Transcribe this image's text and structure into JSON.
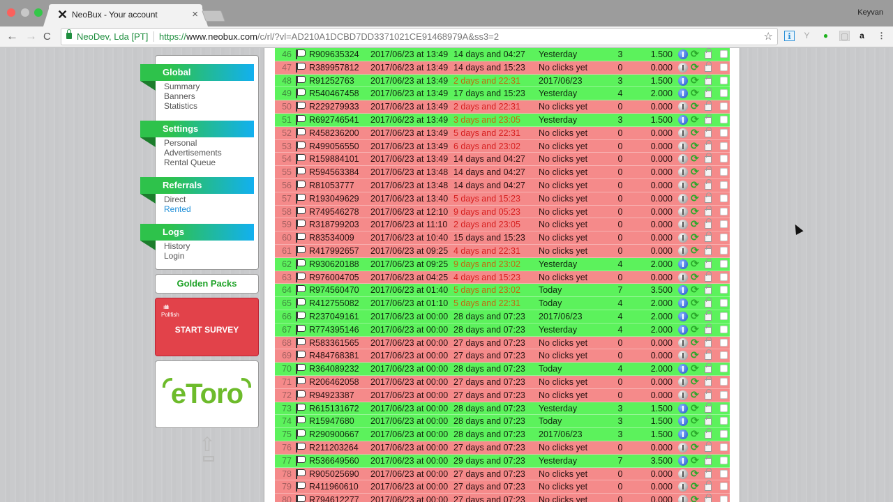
{
  "browser": {
    "tab_title": "NeoBux - Your account",
    "tab_close": "×",
    "profile_name": "Keyvan",
    "ev_certificate": "NeoDev, Lda [PT]",
    "url_scheme": "https://",
    "url_host": "www.neobux.com",
    "url_path": "/c/rl/?vl=AD210A1DCBD7DD3371021CE91468979A&ss3=2",
    "back_icon": "←",
    "forward_icon": "→",
    "reload_icon": "C",
    "star_icon": "☆",
    "extensions": [
      "ℹ",
      "Y",
      "●",
      "▢",
      "a",
      "⋮"
    ]
  },
  "sidebar": {
    "sections": [
      {
        "title": "Global",
        "items": [
          {
            "label": "Summary",
            "active": false
          },
          {
            "label": "Banners",
            "active": false
          },
          {
            "label": "Statistics",
            "active": false
          }
        ]
      },
      {
        "title": "Settings",
        "items": [
          {
            "label": "Personal",
            "active": false
          },
          {
            "label": "Advertisements",
            "active": false
          },
          {
            "label": "Rental Queue",
            "active": false
          }
        ]
      },
      {
        "title": "Referrals",
        "items": [
          {
            "label": "Direct",
            "active": false
          },
          {
            "label": "Rented",
            "active": true
          }
        ]
      },
      {
        "title": "Logs",
        "items": [
          {
            "label": "History",
            "active": false
          },
          {
            "label": "Login",
            "active": false
          }
        ]
      }
    ],
    "golden_packs": "Golden Packs",
    "survey": {
      "brand_icon": "ıılıllı",
      "brand": "Pollfish",
      "cta": "START SURVEY"
    },
    "etoro_logo": "eToro",
    "scroll_top_icon": "⇧"
  },
  "colors": {
    "active_row": "#5cf25c",
    "inactive_row": "#f58a8a",
    "menu_green": "#2ec24b",
    "menu_blue": "#12b0f0"
  },
  "referrals": [
    {
      "n": "46",
      "id": "R909635324",
      "since": "2017/06/23 at 13:49",
      "expires": "14 days and 04:27",
      "exp_warn": false,
      "last": "Yesterday",
      "clicks": "3",
      "avg": "1.500",
      "active": true
    },
    {
      "n": "47",
      "id": "R389957812",
      "since": "2017/06/23 at 13:49",
      "expires": "14 days and 15:23",
      "exp_warn": false,
      "last": "No clicks yet",
      "clicks": "0",
      "avg": "0.000",
      "active": false
    },
    {
      "n": "48",
      "id": "R91252763",
      "since": "2017/06/23 at 13:49",
      "expires": "2 days and 22:31",
      "exp_warn": true,
      "last": "2017/06/23",
      "clicks": "3",
      "avg": "1.500",
      "active": true
    },
    {
      "n": "49",
      "id": "R540467458",
      "since": "2017/06/23 at 13:49",
      "expires": "17 days and 15:23",
      "exp_warn": false,
      "last": "Yesterday",
      "clicks": "4",
      "avg": "2.000",
      "active": true
    },
    {
      "n": "50",
      "id": "R229279933",
      "since": "2017/06/23 at 13:49",
      "expires": "2 days and 22:31",
      "exp_warn": true,
      "last": "No clicks yet",
      "clicks": "0",
      "avg": "0.000",
      "active": false
    },
    {
      "n": "51",
      "id": "R692746541",
      "since": "2017/06/23 at 13:49",
      "expires": "3 days and 23:05",
      "exp_warn": true,
      "last": "Yesterday",
      "clicks": "3",
      "avg": "1.500",
      "active": true
    },
    {
      "n": "52",
      "id": "R458236200",
      "since": "2017/06/23 at 13:49",
      "expires": "5 days and 22:31",
      "exp_warn": true,
      "last": "No clicks yet",
      "clicks": "0",
      "avg": "0.000",
      "active": false
    },
    {
      "n": "53",
      "id": "R499056550",
      "since": "2017/06/23 at 13:49",
      "expires": "6 days and 23:02",
      "exp_warn": true,
      "last": "No clicks yet",
      "clicks": "0",
      "avg": "0.000",
      "active": false
    },
    {
      "n": "54",
      "id": "R159884101",
      "since": "2017/06/23 at 13:49",
      "expires": "14 days and 04:27",
      "exp_warn": false,
      "last": "No clicks yet",
      "clicks": "0",
      "avg": "0.000",
      "active": false
    },
    {
      "n": "55",
      "id": "R594563384",
      "since": "2017/06/23 at 13:48",
      "expires": "14 days and 04:27",
      "exp_warn": false,
      "last": "No clicks yet",
      "clicks": "0",
      "avg": "0.000",
      "active": false
    },
    {
      "n": "56",
      "id": "R81053777",
      "since": "2017/06/23 at 13:48",
      "expires": "14 days and 04:27",
      "exp_warn": false,
      "last": "No clicks yet",
      "clicks": "0",
      "avg": "0.000",
      "active": false
    },
    {
      "n": "57",
      "id": "R193049629",
      "since": "2017/06/23 at 13:40",
      "expires": "5 days and 15:23",
      "exp_warn": true,
      "last": "No clicks yet",
      "clicks": "0",
      "avg": "0.000",
      "active": false
    },
    {
      "n": "58",
      "id": "R749546278",
      "since": "2017/06/23 at 12:10",
      "expires": "9 days and 05:23",
      "exp_warn": true,
      "last": "No clicks yet",
      "clicks": "0",
      "avg": "0.000",
      "active": false
    },
    {
      "n": "59",
      "id": "R318799203",
      "since": "2017/06/23 at 11:10",
      "expires": "2 days and 23:05",
      "exp_warn": true,
      "last": "No clicks yet",
      "clicks": "0",
      "avg": "0.000",
      "active": false
    },
    {
      "n": "60",
      "id": "R83534009",
      "since": "2017/06/23 at 10:40",
      "expires": "15 days and 15:23",
      "exp_warn": false,
      "last": "No clicks yet",
      "clicks": "0",
      "avg": "0.000",
      "active": false
    },
    {
      "n": "61",
      "id": "R417992657",
      "since": "2017/06/23 at 09:25",
      "expires": "4 days and 22:31",
      "exp_warn": true,
      "last": "No clicks yet",
      "clicks": "0",
      "avg": "0.000",
      "active": false
    },
    {
      "n": "62",
      "id": "R930620188",
      "since": "2017/06/23 at 09:25",
      "expires": "9 days and 23:02",
      "exp_warn": true,
      "last": "Yesterday",
      "clicks": "4",
      "avg": "2.000",
      "active": true
    },
    {
      "n": "63",
      "id": "R976004705",
      "since": "2017/06/23 at 04:25",
      "expires": "4 days and 15:23",
      "exp_warn": true,
      "last": "No clicks yet",
      "clicks": "0",
      "avg": "0.000",
      "active": false
    },
    {
      "n": "64",
      "id": "R974560470",
      "since": "2017/06/23 at 01:40",
      "expires": "5 days and 23:02",
      "exp_warn": true,
      "last": "Today",
      "clicks": "7",
      "avg": "3.500",
      "active": true
    },
    {
      "n": "65",
      "id": "R412755082",
      "since": "2017/06/23 at 01:10",
      "expires": "5 days and 22:31",
      "exp_warn": true,
      "last": "Today",
      "clicks": "4",
      "avg": "2.000",
      "active": true
    },
    {
      "n": "66",
      "id": "R237049161",
      "since": "2017/06/23 at 00:00",
      "expires": "28 days and 07:23",
      "exp_warn": false,
      "last": "2017/06/23",
      "clicks": "4",
      "avg": "2.000",
      "active": true
    },
    {
      "n": "67",
      "id": "R774395146",
      "since": "2017/06/23 at 00:00",
      "expires": "28 days and 07:23",
      "exp_warn": false,
      "last": "Yesterday",
      "clicks": "4",
      "avg": "2.000",
      "active": true
    },
    {
      "n": "68",
      "id": "R583361565",
      "since": "2017/06/23 at 00:00",
      "expires": "27 days and 07:23",
      "exp_warn": false,
      "last": "No clicks yet",
      "clicks": "0",
      "avg": "0.000",
      "active": false
    },
    {
      "n": "69",
      "id": "R484768381",
      "since": "2017/06/23 at 00:00",
      "expires": "27 days and 07:23",
      "exp_warn": false,
      "last": "No clicks yet",
      "clicks": "0",
      "avg": "0.000",
      "active": false
    },
    {
      "n": "70",
      "id": "R364089232",
      "since": "2017/06/23 at 00:00",
      "expires": "28 days and 07:23",
      "exp_warn": false,
      "last": "Today",
      "clicks": "4",
      "avg": "2.000",
      "active": true
    },
    {
      "n": "71",
      "id": "R206462058",
      "since": "2017/06/23 at 00:00",
      "expires": "27 days and 07:23",
      "exp_warn": false,
      "last": "No clicks yet",
      "clicks": "0",
      "avg": "0.000",
      "active": false
    },
    {
      "n": "72",
      "id": "R94923387",
      "since": "2017/06/23 at 00:00",
      "expires": "27 days and 07:23",
      "exp_warn": false,
      "last": "No clicks yet",
      "clicks": "0",
      "avg": "0.000",
      "active": false
    },
    {
      "n": "73",
      "id": "R615131672",
      "since": "2017/06/23 at 00:00",
      "expires": "28 days and 07:23",
      "exp_warn": false,
      "last": "Yesterday",
      "clicks": "3",
      "avg": "1.500",
      "active": true
    },
    {
      "n": "74",
      "id": "R15947680",
      "since": "2017/06/23 at 00:00",
      "expires": "28 days and 07:23",
      "exp_warn": false,
      "last": "Today",
      "clicks": "3",
      "avg": "1.500",
      "active": true
    },
    {
      "n": "75",
      "id": "R290900667",
      "since": "2017/06/23 at 00:00",
      "expires": "28 days and 07:23",
      "exp_warn": false,
      "last": "2017/06/23",
      "clicks": "3",
      "avg": "1.500",
      "active": true
    },
    {
      "n": "76",
      "id": "R211203264",
      "since": "2017/06/23 at 00:00",
      "expires": "27 days and 07:23",
      "exp_warn": false,
      "last": "No clicks yet",
      "clicks": "0",
      "avg": "0.000",
      "active": false
    },
    {
      "n": "77",
      "id": "R536649560",
      "since": "2017/06/23 at 00:00",
      "expires": "29 days and 07:23",
      "exp_warn": false,
      "last": "Yesterday",
      "clicks": "7",
      "avg": "3.500",
      "active": true
    },
    {
      "n": "78",
      "id": "R905025690",
      "since": "2017/06/23 at 00:00",
      "expires": "27 days and 07:23",
      "exp_warn": false,
      "last": "No clicks yet",
      "clicks": "0",
      "avg": "0.000",
      "active": false
    },
    {
      "n": "79",
      "id": "R411960610",
      "since": "2017/06/23 at 00:00",
      "expires": "27 days and 07:23",
      "exp_warn": false,
      "last": "No clicks yet",
      "clicks": "0",
      "avg": "0.000",
      "active": false
    },
    {
      "n": "80",
      "id": "R794612277",
      "since": "2017/06/23 at 00:00",
      "expires": "27 days and 07:23",
      "exp_warn": false,
      "last": "No clicks yet",
      "clicks": "0",
      "avg": "0.000",
      "active": false
    }
  ]
}
